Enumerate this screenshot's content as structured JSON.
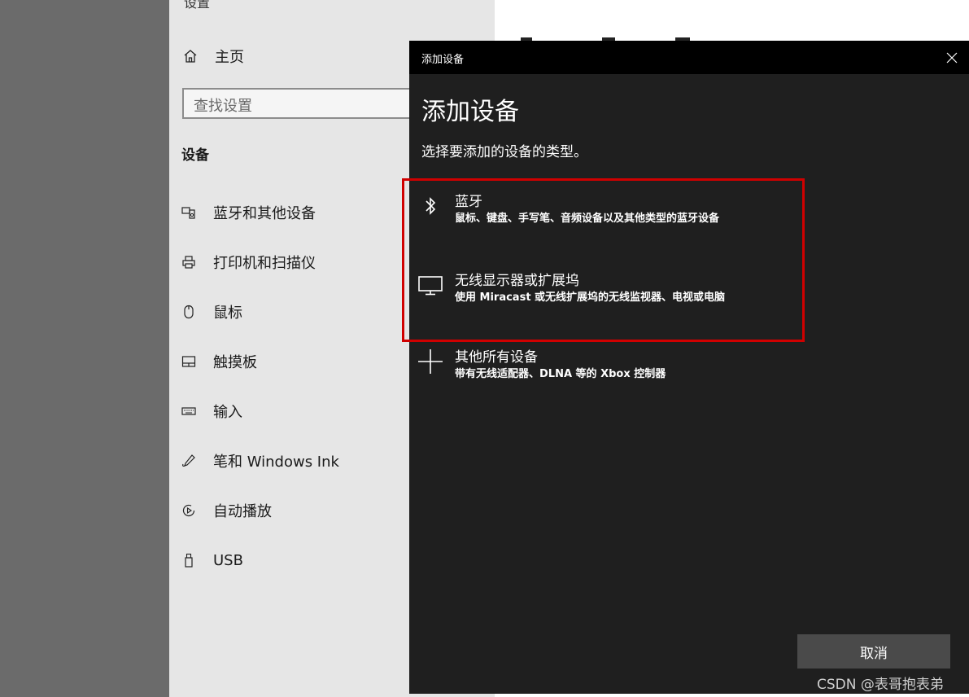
{
  "settings": {
    "title": "设置",
    "home_label": "主页",
    "search_placeholder": "查找设置",
    "section_title": "设备",
    "nav_items": [
      {
        "label": "蓝牙和其他设备",
        "icon": "bluetooth-devices-icon"
      },
      {
        "label": "打印机和扫描仪",
        "icon": "printer-icon"
      },
      {
        "label": "鼠标",
        "icon": "mouse-icon"
      },
      {
        "label": "触摸板",
        "icon": "touchpad-icon"
      },
      {
        "label": "输入",
        "icon": "keyboard-icon"
      },
      {
        "label": "笔和 Windows Ink",
        "icon": "pen-icon"
      },
      {
        "label": "自动播放",
        "icon": "autoplay-icon"
      },
      {
        "label": "USB",
        "icon": "usb-icon"
      }
    ]
  },
  "dialog": {
    "window_title": "添加设备",
    "heading": "添加设备",
    "subtitle": "选择要添加的设备的类型。",
    "options": [
      {
        "title": "蓝牙",
        "description": "鼠标、键盘、手写笔、音频设备以及其他类型的蓝牙设备",
        "icon": "bluetooth-icon"
      },
      {
        "title": "无线显示器或扩展坞",
        "description": "使用 Miracast 或无线扩展坞的无线监视器、电视或电脑",
        "icon": "monitor-icon"
      },
      {
        "title": "其他所有设备",
        "description": "带有无线适配器、DLNA 等的 Xbox 控制器",
        "icon": "plus-icon"
      }
    ],
    "cancel_label": "取消"
  },
  "watermark": "CSDN @表哥抱表弟",
  "colors": {
    "dialog_bg": "#1f1f1f",
    "titlebar_bg": "#000000",
    "highlight_border": "#d00000",
    "button_bg": "#4a4a4a",
    "settings_bg": "#e6e6e6"
  }
}
